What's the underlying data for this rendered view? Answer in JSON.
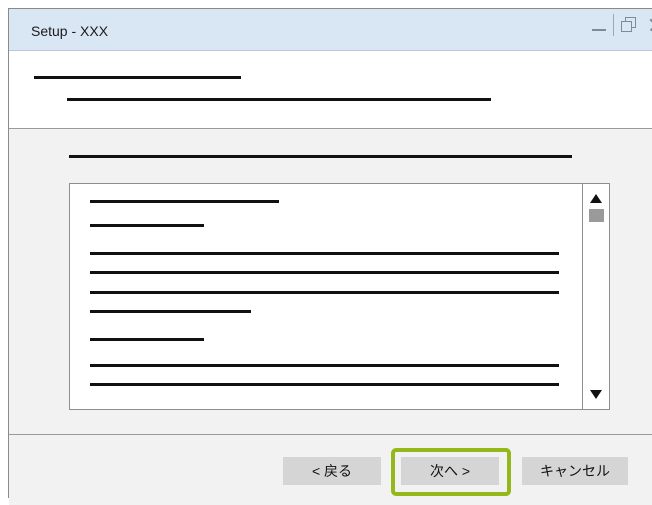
{
  "window": {
    "title": "Setup - XXX",
    "controls": [
      "minimize-icon",
      "restore-icon",
      "close-icon"
    ]
  },
  "footer": {
    "back_label": "< 戻る",
    "next_label": "次へ >",
    "cancel_label": "キャンセル"
  },
  "colors": {
    "titlebar": "#d9e6f3",
    "panel": "#f2f2f2",
    "button": "#d5d5d5",
    "highlight": "#94b81a"
  }
}
